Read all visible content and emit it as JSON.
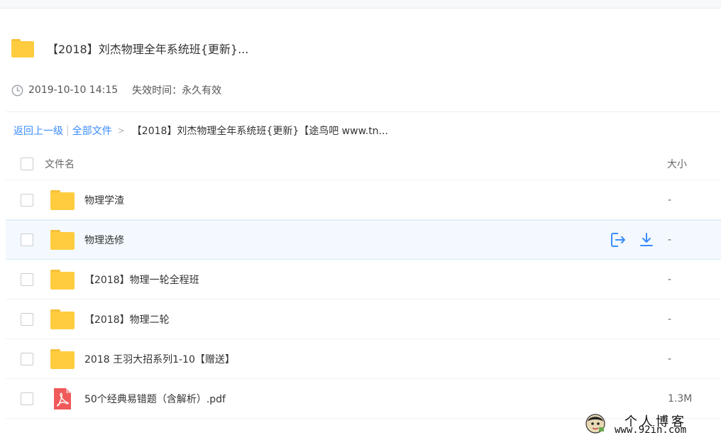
{
  "share": {
    "title": "【2018】刘杰物理全年系统班{更新}...",
    "created_time": "2019-10-10 14:15",
    "expiry": "失效时间：永久有效"
  },
  "breadcrumb": {
    "back": "返回上一级",
    "separator": "|",
    "all_files": "全部文件",
    "arrow": ">",
    "current": "【2018】刘杰物理全年系统班{更新}【途鸟吧 www.tn..."
  },
  "list": {
    "header": {
      "name": "文件名",
      "size": "大小"
    },
    "rows": [
      {
        "type": "folder",
        "name": "物理学渣",
        "size": "-"
      },
      {
        "type": "folder",
        "name": "物理选修",
        "size": "-"
      },
      {
        "type": "folder",
        "name": "【2018】物理一轮全程班",
        "size": "-"
      },
      {
        "type": "folder",
        "name": "【2018】物理二轮",
        "size": "-"
      },
      {
        "type": "folder",
        "name": "2018 王羽大招系列1-10【赠送】",
        "size": "-"
      },
      {
        "type": "pdf",
        "name": "50个经典易错题（含解析）.pdf",
        "size": "1.3M"
      }
    ],
    "hovered_row_index": 1
  },
  "watermark": {
    "line1": "个人博客",
    "line2": "www.92in.com"
  },
  "colors": {
    "accent": "#3b8cff",
    "folder": "#ffcc3f",
    "pdf": "#f05a5a",
    "hover_row": "#f3f9fe"
  }
}
